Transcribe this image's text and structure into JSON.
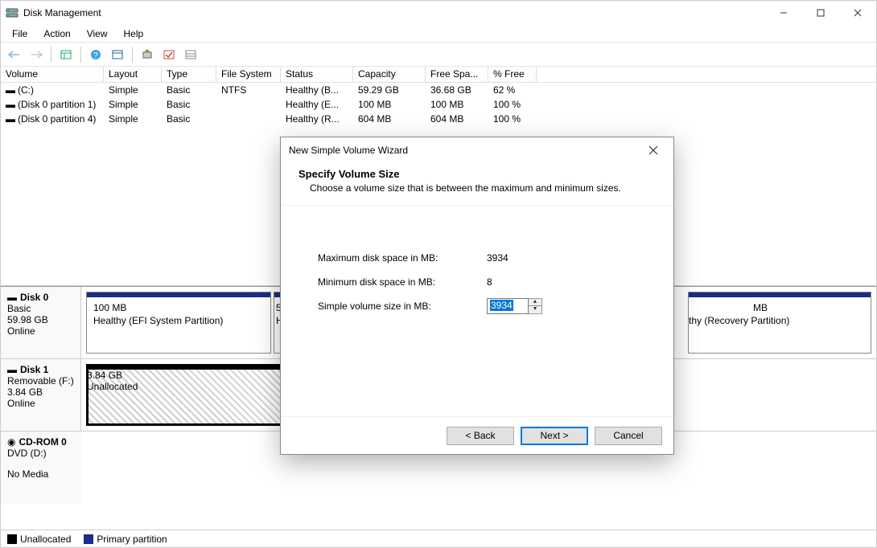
{
  "titlebar": {
    "title": "Disk Management"
  },
  "menu": {
    "file": "File",
    "action": "Action",
    "view": "View",
    "help": "Help"
  },
  "columns": {
    "volume": "Volume",
    "layout": "Layout",
    "type": "Type",
    "filesystem": "File System",
    "status": "Status",
    "capacity": "Capacity",
    "freespace": "Free Spa...",
    "pctfree": "% Free"
  },
  "volumes": [
    {
      "name": "(C:)",
      "layout": "Simple",
      "type": "Basic",
      "fs": "NTFS",
      "status": "Healthy (B...",
      "capacity": "59.29 GB",
      "free": "36.68 GB",
      "pct": "62 %"
    },
    {
      "name": "(Disk 0 partition 1)",
      "layout": "Simple",
      "type": "Basic",
      "fs": "",
      "status": "Healthy (E...",
      "capacity": "100 MB",
      "free": "100 MB",
      "pct": "100 %"
    },
    {
      "name": "(Disk 0 partition 4)",
      "layout": "Simple",
      "type": "Basic",
      "fs": "",
      "status": "Healthy (R...",
      "capacity": "604 MB",
      "free": "604 MB",
      "pct": "100 %"
    }
  ],
  "disks": {
    "d0": {
      "name": "Disk 0",
      "sub1": "Basic",
      "sub2": "59.98 GB",
      "sub3": "Online",
      "p0": {
        "l1": "100 MB",
        "l2": "Healthy (EFI System Partition)"
      },
      "p1": {
        "l1": "5",
        "l2": "H"
      },
      "p2": {
        "l1": "MB",
        "l2": "thy (Recovery Partition)"
      }
    },
    "d1": {
      "name": "Disk 1",
      "sub1": "Removable (F:)",
      "sub2": "3.84 GB",
      "sub3": "Online",
      "p0": {
        "l1": "3.84 GB",
        "l2": "Unallocated"
      }
    },
    "d2": {
      "name": "CD-ROM 0",
      "sub1": "DVD (D:)",
      "sub2": "",
      "sub3": "No Media"
    }
  },
  "legend": {
    "unalloc": "Unallocated",
    "primary": "Primary partition"
  },
  "dialog": {
    "title": "New Simple Volume Wizard",
    "heading": "Specify Volume Size",
    "subheading": "Choose a volume size that is between the maximum and minimum sizes.",
    "max_label": "Maximum disk space in MB:",
    "max_value": "3934",
    "min_label": "Minimum disk space in MB:",
    "min_value": "8",
    "size_label": "Simple volume size in MB:",
    "size_value": "3934",
    "back": "< Back",
    "next": "Next >",
    "cancel": "Cancel"
  }
}
